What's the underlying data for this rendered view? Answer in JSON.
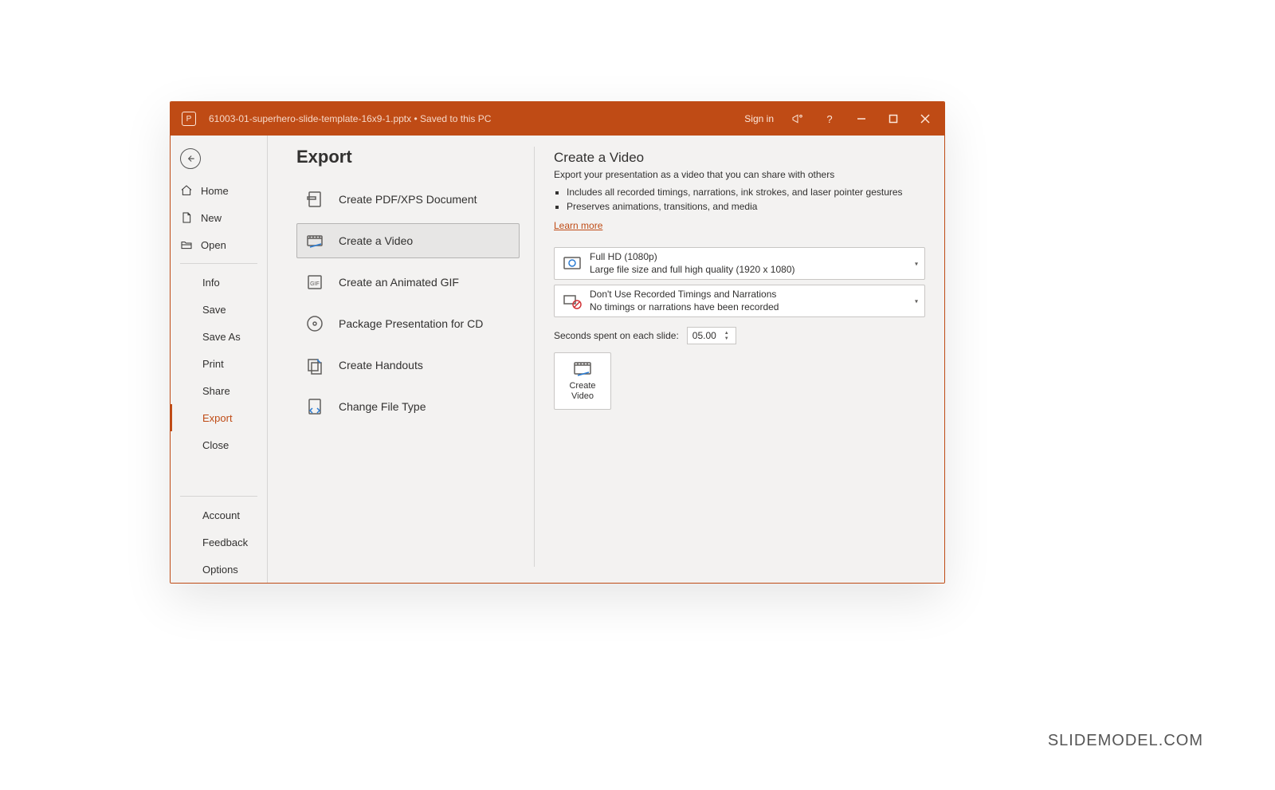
{
  "titlebar": {
    "filename": "61003-01-superhero-slide-template-16x9-1.pptx",
    "save_status": "Saved to this PC",
    "signin": "Sign in"
  },
  "nav": {
    "home": "Home",
    "new": "New",
    "open": "Open",
    "info": "Info",
    "save": "Save",
    "saveas": "Save As",
    "print": "Print",
    "share": "Share",
    "export": "Export",
    "close": "Close",
    "account": "Account",
    "feedback": "Feedback",
    "options": "Options"
  },
  "page": {
    "title": "Export",
    "items": {
      "pdf": "Create PDF/XPS Document",
      "video": "Create a Video",
      "gif": "Create an Animated GIF",
      "cd": "Package Presentation for CD",
      "handouts": "Create Handouts",
      "filetype": "Change File Type"
    }
  },
  "panel": {
    "heading": "Create a Video",
    "desc": "Export your presentation as a video that you can share with others",
    "bullet1": "Includes all recorded timings, narrations, ink strokes, and laser pointer gestures",
    "bullet2": "Preserves animations, transitions, and media",
    "learn_more": "Learn more",
    "quality": {
      "title": "Full HD (1080p)",
      "sub": "Large file size and full high quality (1920 x 1080)"
    },
    "timings": {
      "title": "Don't Use Recorded Timings and Narrations",
      "sub": "No timings or narrations have been recorded"
    },
    "seconds_label": "Seconds spent on each slide:",
    "seconds_value": "05.00",
    "create_label": "Create\nVideo"
  },
  "watermark": "SLIDEMODEL.COM"
}
